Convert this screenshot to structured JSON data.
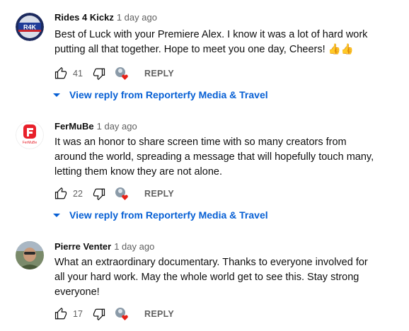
{
  "colors": {
    "link": "#065fd4",
    "meta": "#606060",
    "heart": "#e62117"
  },
  "comments": [
    {
      "author": "Rides 4 Kickz",
      "time": "1 day ago",
      "avatar_text": "R4K",
      "lines": [
        "Best of Luck with your Premiere Alex.  I know it was a lot of hard work",
        "putting all that together.  Hope to meet you one day, Cheers! 👍👍"
      ],
      "likes": "41",
      "reply_label": "REPLY",
      "view_replies": "View reply from Reporterfy Media & Travel"
    },
    {
      "author": "FerMuBe",
      "time": "1 day ago",
      "avatar_text": "FerMuBe",
      "lines": [
        "It was an honor to share screen time with so many creators from",
        "around the world, spreading a message that will hopefully touch many,",
        "letting them know they are not alone."
      ],
      "likes": "22",
      "reply_label": "REPLY",
      "view_replies": "View reply from Reporterfy Media & Travel"
    },
    {
      "author": "Pierre Venter",
      "time": "1 day ago",
      "lines": [
        "What an extraordinary documentary. Thanks to everyone involved for",
        "all your hard work. May the whole world get to see this. Stay strong",
        "everyone!"
      ],
      "likes": "17",
      "reply_label": "REPLY"
    }
  ]
}
